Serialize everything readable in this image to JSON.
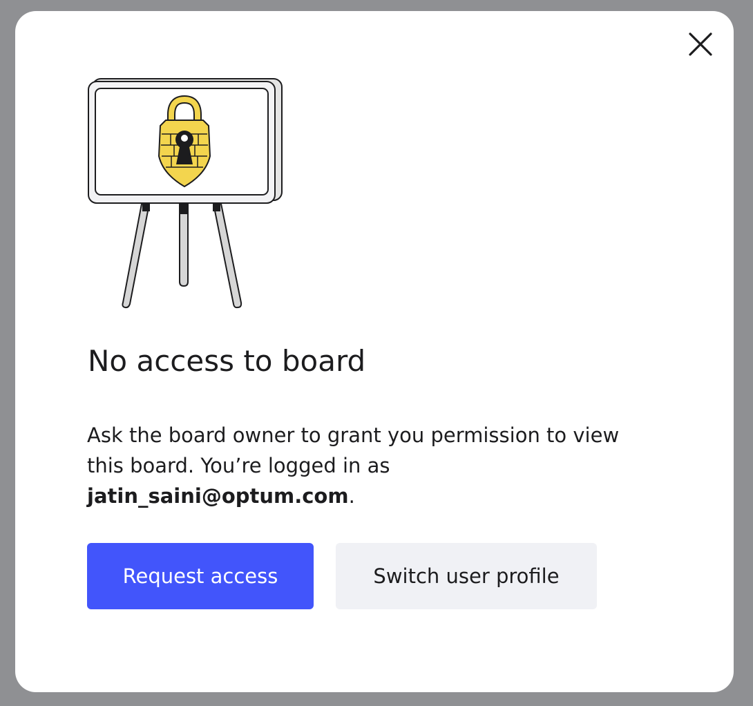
{
  "dialog": {
    "close_icon": "close-icon",
    "illustration_icon": "locked-board-easel-illustration",
    "title": "No access to board",
    "message_part1": "Ask the board owner to grant you permission to view this board. You’re logged in as ",
    "email": "jatin_saini@optum.com",
    "message_part2": ".",
    "primary_button_label": "Request access",
    "secondary_button_label": "Switch user profile"
  },
  "colors": {
    "overlay": "#8f9093",
    "primary_button": "#4255fb",
    "secondary_button": "#f0f1f5",
    "lock_yellow": "#f3d54e"
  }
}
